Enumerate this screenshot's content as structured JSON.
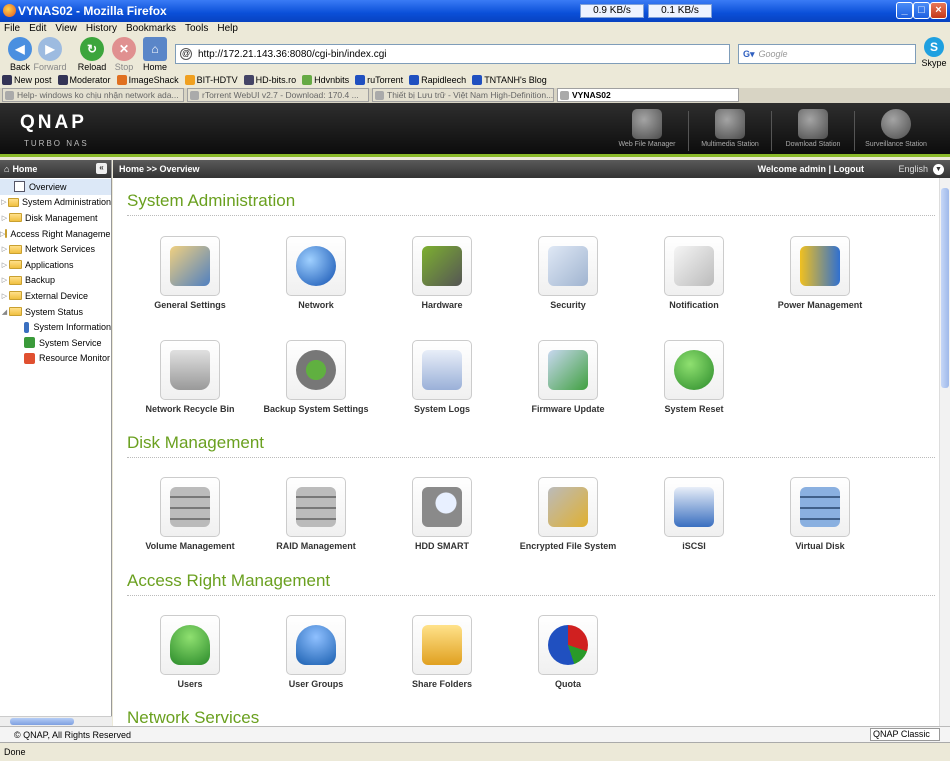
{
  "window": {
    "title": "VYNAS02 - Mozilla Firefox",
    "down_speed": "0.9 KB/s",
    "up_speed": "0.1 KB/s"
  },
  "menu": [
    "File",
    "Edit",
    "View",
    "History",
    "Bookmarks",
    "Tools",
    "Help"
  ],
  "nav": {
    "back": "Back",
    "forward": "Forward",
    "reload": "Reload",
    "stop": "Stop",
    "home": "Home",
    "skype": "Skype",
    "url": "http://172.21.143.36:8080/cgi-bin/index.cgi",
    "search_placeholder": "Google"
  },
  "bookmarks": [
    "New post",
    "Moderator",
    "ImageShack",
    "BIT-HDTV",
    "HD-bits.ro",
    "Hdvnbits",
    "ruTorrent",
    "Rapidleech",
    "TNTANH's Blog"
  ],
  "tabs": [
    "Help- windows ko chịu nhận network ada...",
    "rTorrent WebUI v2.7 - Download: 170.4 ...",
    "Thiết bị Lưu trữ - Việt Nam High-Definition...",
    "VYNAS02"
  ],
  "banner": {
    "logo": "QNAP",
    "sub": "TURBO NAS",
    "apps": [
      "Web File Manager",
      "Multimedia Station",
      "Download Station",
      "Surveillance Station"
    ]
  },
  "sidebar": {
    "title": "Home",
    "items": [
      "Overview",
      "System Administration",
      "Disk Management",
      "Access Right Management",
      "Network Services",
      "Applications",
      "Backup",
      "External Device",
      "System Status"
    ],
    "sub": [
      "System Information",
      "System Service",
      "Resource Monitor"
    ]
  },
  "header": {
    "breadcrumb": "Home >> Overview",
    "welcome": "Welcome admin | Logout",
    "language": "English"
  },
  "sections": [
    {
      "title": "System Administration",
      "items": [
        "General Settings",
        "Network",
        "Hardware",
        "Security",
        "Notification",
        "Power Management",
        "Network Recycle Bin",
        "Backup System Settings",
        "System Logs",
        "Firmware Update",
        "System Reset"
      ]
    },
    {
      "title": "Disk Management",
      "items": [
        "Volume Management",
        "RAID Management",
        "HDD SMART",
        "Encrypted File System",
        "iSCSI",
        "Virtual Disk"
      ]
    },
    {
      "title": "Access Right Management",
      "items": [
        "Users",
        "User Groups",
        "Share Folders",
        "Quota"
      ]
    },
    {
      "title": "Network Services",
      "items": []
    }
  ],
  "footer": {
    "copyright": "© QNAP, All Rights Reserved",
    "theme": "QNAP Classic"
  },
  "status": "Done",
  "colors": {
    "accent": "#6aa01f",
    "banner": "#1a1a1a",
    "titlebar": "#0a4fd8"
  }
}
